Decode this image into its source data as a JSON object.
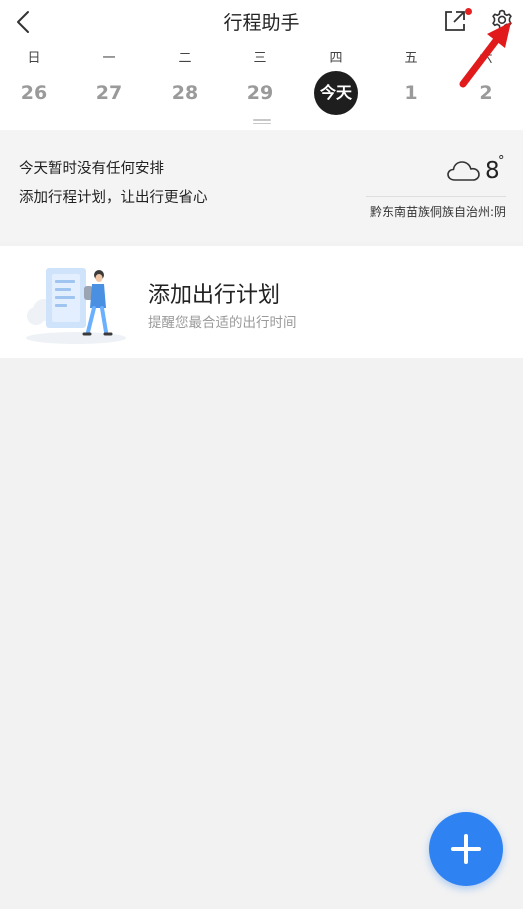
{
  "header": {
    "title": "行程助手"
  },
  "week": {
    "days": [
      {
        "weekday": "日",
        "date": "26"
      },
      {
        "weekday": "一",
        "date": "27"
      },
      {
        "weekday": "二",
        "date": "28"
      },
      {
        "weekday": "三",
        "date": "29"
      },
      {
        "weekday": "四",
        "date": "今天"
      },
      {
        "weekday": "五",
        "date": "1"
      },
      {
        "weekday": "六",
        "date": "2"
      }
    ]
  },
  "summary": {
    "line1": "今天暂时没有任何安排",
    "line2": "添加行程计划，让出行更省心",
    "weather": {
      "icon": "cloudy-icon",
      "temperature": "8",
      "unit": "°",
      "location": "黔东南苗族侗族自治州:阴"
    }
  },
  "plan_card": {
    "title": "添加出行计划",
    "subtitle": "提醒您最合适的出行时间"
  },
  "colors": {
    "accent": "#2f82f2",
    "today_bg": "#1e1e1e",
    "notification": "#e52222",
    "annotation_arrow": "#e11b1b"
  },
  "icons": [
    "back-icon",
    "share-icon",
    "gear-icon",
    "cloudy-icon",
    "plus-icon"
  ]
}
